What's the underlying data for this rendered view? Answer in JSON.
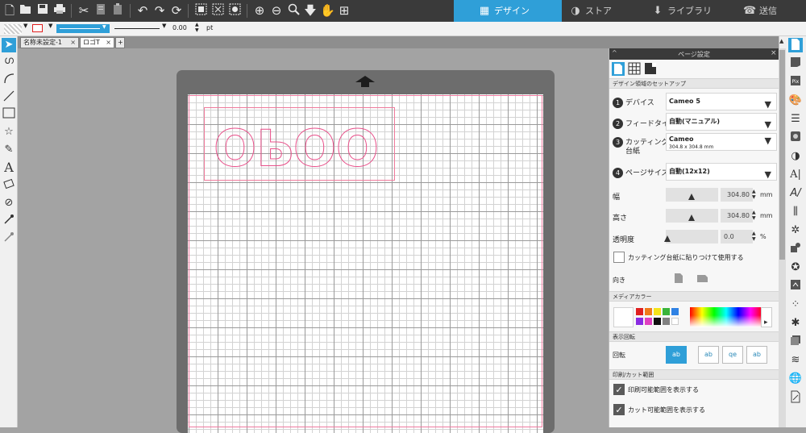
{
  "tabs": [
    {
      "label": "デザイン",
      "icon": "grid-icon",
      "active": true
    },
    {
      "label": "ストア",
      "icon": "store-icon",
      "active": false
    },
    {
      "label": "ライブラリ",
      "icon": "library-icon",
      "active": false
    },
    {
      "label": "送信",
      "icon": "send-icon",
      "active": false
    }
  ],
  "linebar": {
    "line_width": "0.00",
    "unit": "pt"
  },
  "doc_tabs": [
    {
      "label": "名称未設定-1"
    },
    {
      "label": "ロゴT"
    }
  ],
  "doc_tab_close": "×",
  "doc_tab_add": "+",
  "artwork_text": "OPOO",
  "panel": {
    "title": "ページ設定",
    "collapse": "^",
    "close": "×",
    "section_setup": "デザイン領域のセットアップ",
    "device_label": "デバイス",
    "device_value": "Cameo 5",
    "feed_label": "フィードタイプ",
    "feed_value": "自動(マニュアル)",
    "mat_label_1": "カッティング用",
    "mat_label_2": "台紙",
    "mat_value": "Cameo",
    "mat_size": "304.8 x 304.8 mm",
    "page_label": "ページサイズ",
    "page_value": "自動(12x12)",
    "width_label": "幅",
    "width_value": "304.80",
    "height_label": "高さ",
    "height_value": "304.80",
    "opacity_label": "透明度",
    "opacity_value": "0.0",
    "unit_mm": "mm",
    "unit_pct": "%",
    "mat_check_label": "カッティング台紙に貼りつけて使用する",
    "orient_label": "向き",
    "section_media": "メディアカラー",
    "section_rotate": "表示回転",
    "rotate_label": "回転",
    "section_print": "印刷/カット範囲",
    "print_check_label": "印刷可能範囲を表示する",
    "cut_check_label": "カット可能範囲を表示する",
    "step_nums": [
      "1",
      "2",
      "3",
      "4"
    ]
  },
  "colors": {
    "accent": "#2f9fd8",
    "toolbar_bg": "#3a3a3a",
    "cut_line": "#e8508a",
    "swatches": [
      "#e02020",
      "#f07a1a",
      "#f4e31a",
      "#3ab43a",
      "#2f82e4",
      "#8a2be2",
      "#e040c0",
      "#111111",
      "#808080",
      "#ffffff"
    ]
  }
}
